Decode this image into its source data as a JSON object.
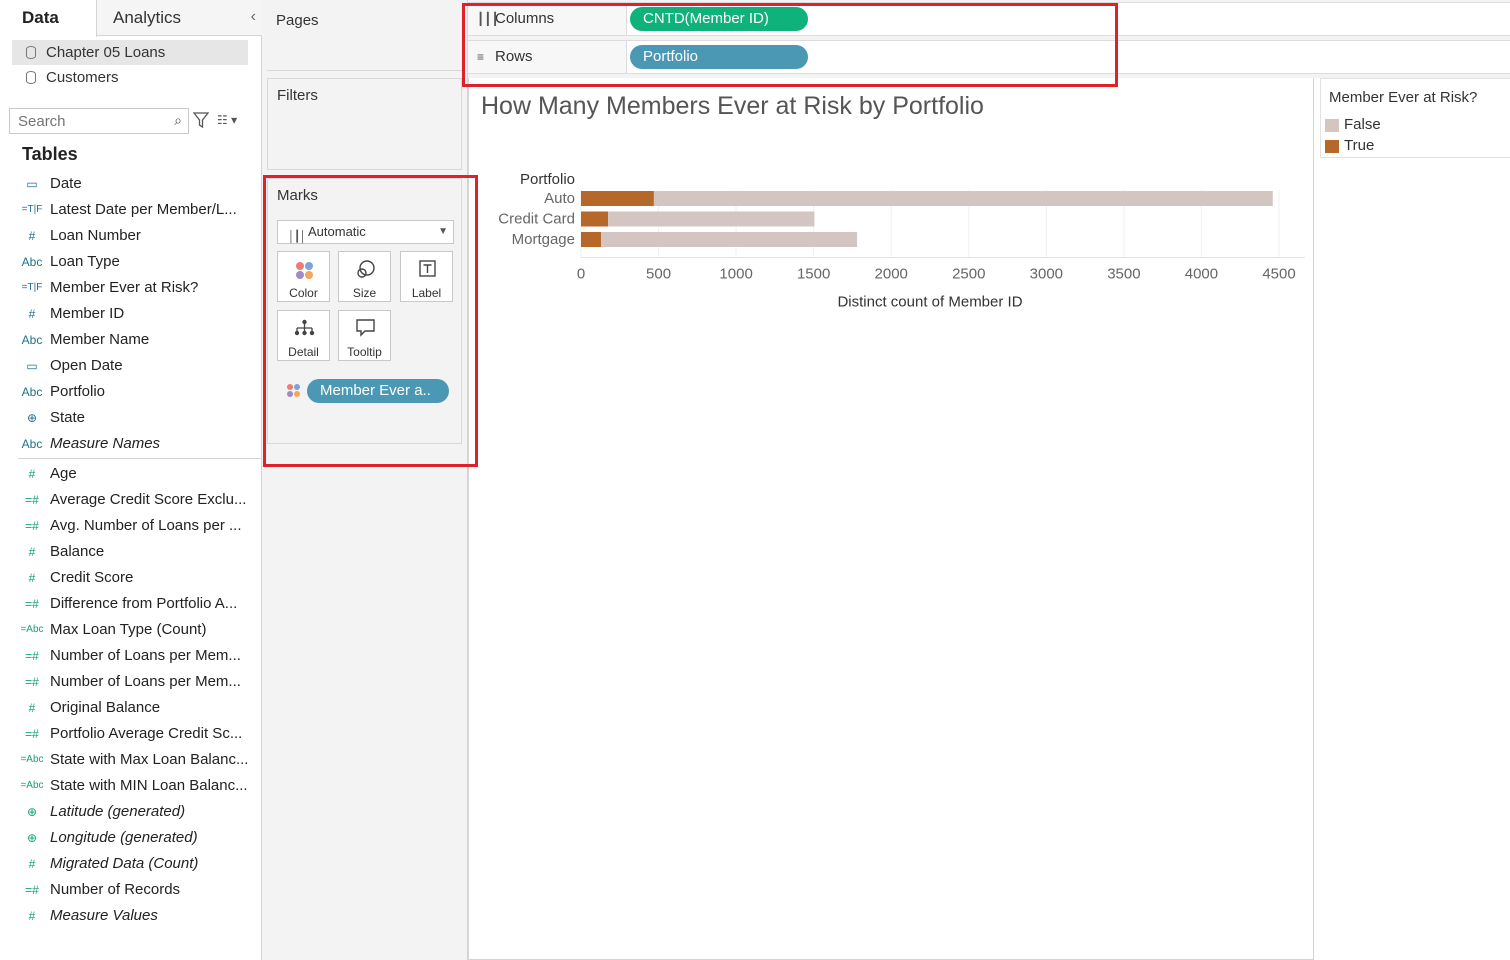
{
  "data_pane": {
    "tabs": [
      "Data",
      "Analytics"
    ],
    "collapse_glyph": "‹",
    "datasources": [
      {
        "label": "Chapter 05 Loans",
        "selected": true
      },
      {
        "label": "Customers",
        "selected": false
      }
    ],
    "search_placeholder": "Search",
    "tables_heading": "Tables",
    "dimensions": [
      {
        "icon": "date-icon",
        "glyph": "▭",
        "label": "Date",
        "italic": false
      },
      {
        "icon": "calc-boolean-icon",
        "glyph": "=T|F",
        "label": "Latest Date per Member/L...",
        "italic": false
      },
      {
        "icon": "number-icon",
        "glyph": "#",
        "label": "Loan Number",
        "italic": false
      },
      {
        "icon": "string-icon",
        "glyph": "Abc",
        "label": "Loan Type",
        "italic": false
      },
      {
        "icon": "calc-boolean-icon",
        "glyph": "=T|F",
        "label": "Member Ever at Risk?",
        "italic": false
      },
      {
        "icon": "number-icon",
        "glyph": "#",
        "label": "Member ID",
        "italic": false
      },
      {
        "icon": "string-icon",
        "glyph": "Abc",
        "label": "Member Name",
        "italic": false
      },
      {
        "icon": "date-icon",
        "glyph": "▭",
        "label": "Open Date",
        "italic": false
      },
      {
        "icon": "string-icon",
        "glyph": "Abc",
        "label": "Portfolio",
        "italic": false
      },
      {
        "icon": "globe-icon",
        "glyph": "⊕",
        "label": "State",
        "italic": false
      },
      {
        "icon": "string-icon",
        "glyph": "Abc",
        "label": "Measure Names",
        "italic": true
      }
    ],
    "measures": [
      {
        "icon": "number-icon",
        "glyph": "#",
        "label": "Age",
        "italic": false
      },
      {
        "icon": "calc-number-icon",
        "glyph": "=#",
        "label": "Average Credit Score Exclu...",
        "italic": false
      },
      {
        "icon": "calc-number-icon",
        "glyph": "=#",
        "label": "Avg. Number of Loans per ...",
        "italic": false
      },
      {
        "icon": "number-icon",
        "glyph": "#",
        "label": "Balance",
        "italic": false
      },
      {
        "icon": "number-icon",
        "glyph": "#",
        "label": "Credit Score",
        "italic": false
      },
      {
        "icon": "calc-number-icon",
        "glyph": "=#",
        "label": "Difference from Portfolio A...",
        "italic": false
      },
      {
        "icon": "calc-string-icon",
        "glyph": "=Abc",
        "label": "Max Loan Type (Count)",
        "italic": false
      },
      {
        "icon": "calc-number-icon",
        "glyph": "=#",
        "label": "Number of Loans per Mem...",
        "italic": false
      },
      {
        "icon": "calc-number-icon",
        "glyph": "=#",
        "label": "Number of Loans per Mem...",
        "italic": false
      },
      {
        "icon": "number-icon",
        "glyph": "#",
        "label": "Original Balance",
        "italic": false
      },
      {
        "icon": "calc-number-icon",
        "glyph": "=#",
        "label": "Portfolio Average Credit Sc...",
        "italic": false
      },
      {
        "icon": "calc-string-icon",
        "glyph": "=Abc",
        "label": "State with Max Loan Balanc...",
        "italic": false
      },
      {
        "icon": "calc-string-icon",
        "glyph": "=Abc",
        "label": "State with MIN Loan Balanc...",
        "italic": false
      },
      {
        "icon": "globe-icon",
        "glyph": "⊕",
        "label": "Latitude (generated)",
        "italic": true
      },
      {
        "icon": "globe-icon",
        "glyph": "⊕",
        "label": "Longitude (generated)",
        "italic": true
      },
      {
        "icon": "number-icon",
        "glyph": "#",
        "label": "Migrated Data (Count)",
        "italic": true
      },
      {
        "icon": "calc-number-icon",
        "glyph": "=#",
        "label": "Number of Records",
        "italic": false
      },
      {
        "icon": "number-icon",
        "glyph": "#",
        "label": "Measure Values",
        "italic": true
      }
    ]
  },
  "cards": {
    "pages_title": "Pages",
    "filters_title": "Filters",
    "marks_title": "Marks",
    "mark_type": "Automatic",
    "mark_buttons": [
      {
        "name": "color",
        "label": "Color"
      },
      {
        "name": "size",
        "label": "Size"
      },
      {
        "name": "label",
        "label": "Label"
      },
      {
        "name": "detail",
        "label": "Detail"
      },
      {
        "name": "tooltip",
        "label": "Tooltip"
      }
    ],
    "color_pill": "Member Ever a.."
  },
  "shelves": {
    "columns_label": "Columns",
    "columns_pill": "CNTD(Member ID)",
    "rows_label": "Rows",
    "rows_pill": "Portfolio"
  },
  "colors": {
    "measure_pill": "#10b27c",
    "dimension_pill": "#4b98b5",
    "false": "#d3c6c2",
    "true": "#b5682a",
    "highlight_box": "#e0212b"
  },
  "legend": {
    "title": "Member Ever at Risk?",
    "items": [
      {
        "label": "False",
        "color": "#d3c6c2"
      },
      {
        "label": "True",
        "color": "#b5682a"
      }
    ]
  },
  "view": {
    "title": "How Many Members Ever at Risk by Portfolio"
  },
  "chart_data": {
    "type": "bar",
    "orientation": "horizontal",
    "stacked": true,
    "title": "How Many Members Ever at Risk by Portfolio",
    "row_header": "Portfolio",
    "categories": [
      "Auto",
      "Credit Card",
      "Mortgage"
    ],
    "series": [
      {
        "name": "True",
        "color": "#b5682a",
        "values": [
          470,
          175,
          130
        ]
      },
      {
        "name": "False",
        "color": "#d3c6c2",
        "values": [
          3990,
          1330,
          1650
        ]
      }
    ],
    "xlabel": "Distinct count of Member ID",
    "xlim": [
      0,
      4500
    ],
    "xticks": [
      0,
      500,
      1000,
      1500,
      2000,
      2500,
      3000,
      3500,
      4000,
      4500
    ],
    "grid": true
  }
}
